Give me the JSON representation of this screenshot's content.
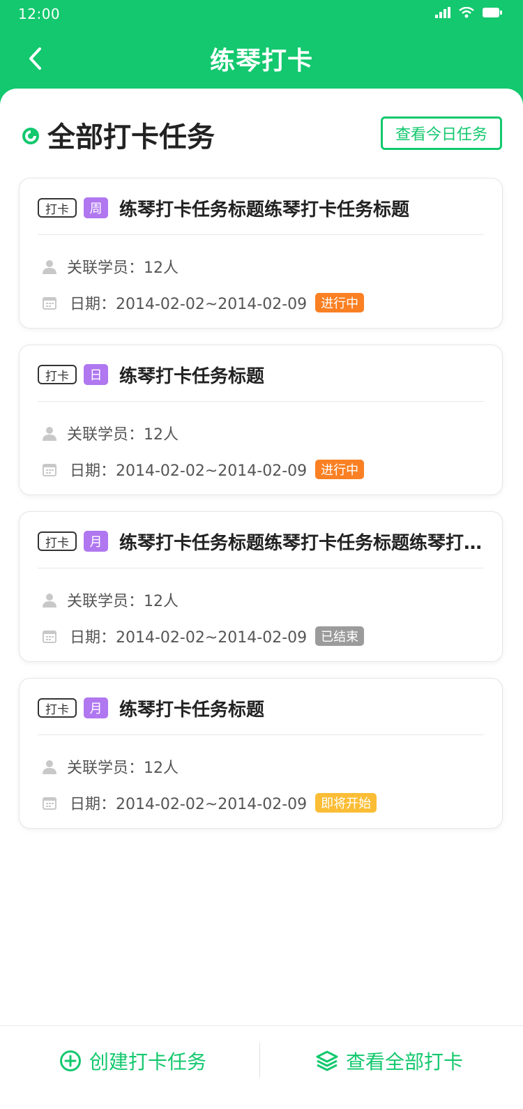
{
  "status_bar": {
    "time": "12:00"
  },
  "nav": {
    "title": "练琴打卡"
  },
  "section": {
    "title": "全部打卡任务",
    "today_button": "查看今日任务"
  },
  "colors": {
    "brand": "#13c86e",
    "period_tag": "#b077f0",
    "in_progress": "#fa8023",
    "ended": "#9b9b9b",
    "upcoming": "#fbbd35"
  },
  "tasks": [
    {
      "checkin_tag": "打卡",
      "period": "周",
      "title": "练琴打卡任务标题练琴打卡任务标题",
      "members": "关联学员：12人",
      "date": "日期：2014-02-02~2014-02-09",
      "status": "进行中",
      "status_color": "#fa8023"
    },
    {
      "checkin_tag": "打卡",
      "period": "日",
      "title": "练琴打卡任务标题",
      "members": "关联学员：12人",
      "date": "日期：2014-02-02~2014-02-09",
      "status": "进行中",
      "status_color": "#fa8023"
    },
    {
      "checkin_tag": "打卡",
      "period": "月",
      "title": "练琴打卡任务标题练琴打卡任务标题练琴打卡任务标题",
      "members": "关联学员：12人",
      "date": "日期：2014-02-02~2014-02-09",
      "status": "已结束",
      "status_color": "#9b9b9b"
    },
    {
      "checkin_tag": "打卡",
      "period": "月",
      "title": "练琴打卡任务标题",
      "members": "关联学员：12人",
      "date": "日期：2014-02-02~2014-02-09",
      "status": "即将开始",
      "status_color": "#fbbd35"
    }
  ],
  "bottom": {
    "create_label": "创建打卡任务",
    "view_all_label": "查看全部打卡"
  }
}
